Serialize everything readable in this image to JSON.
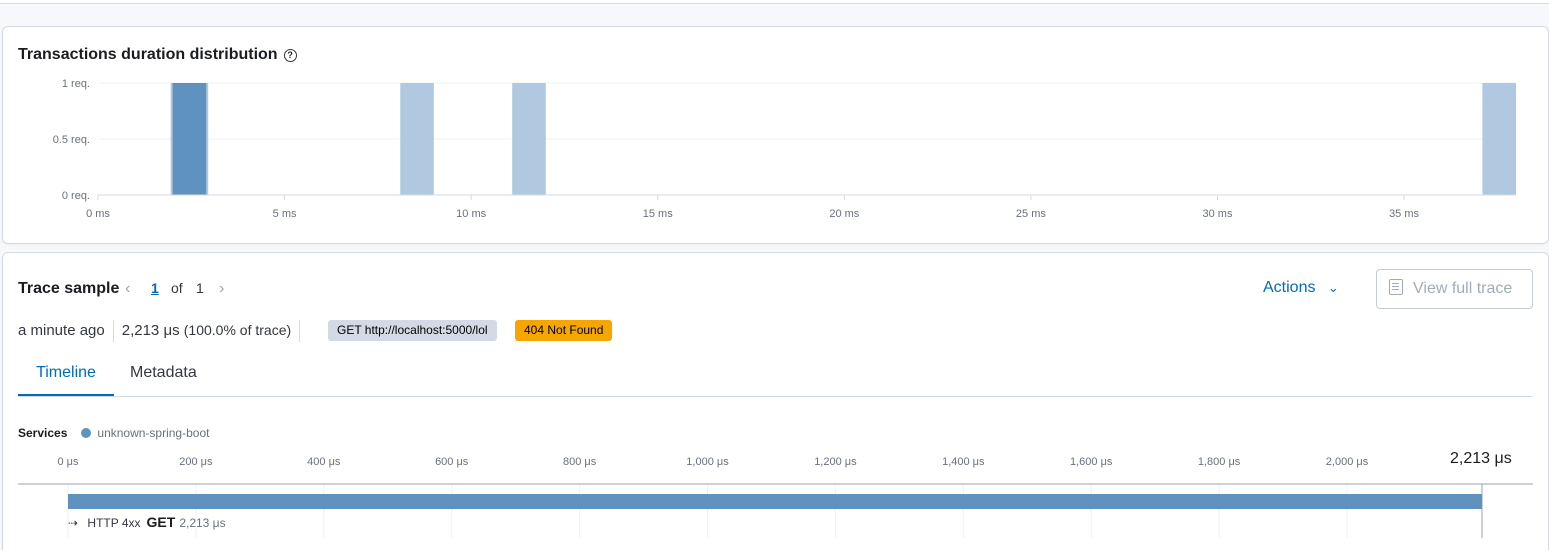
{
  "distribution": {
    "title": "Transactions duration distribution",
    "help_icon": "question-circle-icon"
  },
  "chart_data": {
    "type": "bar",
    "x_unit": "ms",
    "y_ticks": [
      "1 req.",
      "0.5 req.",
      "0 req."
    ],
    "x_ticks": [
      "0 ms",
      "5 ms",
      "10 ms",
      "15 ms",
      "20 ms",
      "25 ms",
      "30 ms",
      "35 ms"
    ],
    "xlim": [
      0,
      38
    ],
    "ylim": [
      0,
      1
    ],
    "bucket_size": 0.9,
    "buckets": [
      {
        "x": 2.0,
        "value": 1,
        "selected": true
      },
      {
        "x": 8.1,
        "value": 1,
        "selected": false
      },
      {
        "x": 11.1,
        "value": 1,
        "selected": false
      },
      {
        "x": 37.1,
        "value": 1,
        "selected": false
      }
    ],
    "colors": {
      "selected": "#6092c0",
      "default": "#b0c9e0"
    },
    "grid": true
  },
  "trace": {
    "title": "Trace sample",
    "page_current": "1",
    "page_of": "of",
    "page_total": "1",
    "actions_label": "Actions",
    "view_full_trace_label": "View full trace",
    "timestamp": "a minute ago",
    "duration": "2,213 μs",
    "duration_pct": "(100.0% of trace)",
    "request_badge": "GET http://localhost:5000/lol",
    "status_badge": "404 Not Found",
    "tabs": [
      {
        "label": "Timeline",
        "active": true
      },
      {
        "label": "Metadata",
        "active": false
      }
    ],
    "services_label": "Services",
    "service_name": "unknown-spring-boot",
    "timeline_ticks": [
      "0 μs",
      "200 μs",
      "400 μs",
      "600 μs",
      "800 μs",
      "1,000 μs",
      "1,200 μs",
      "1,400 μs",
      "1,600 μs",
      "1,800 μs",
      "2,000 μs"
    ],
    "timeline_total": "2,213 μs",
    "span": {
      "type": "HTTP 4xx",
      "name": "GET",
      "duration": "2,213 μs",
      "icon": "exit-arrow-icon"
    }
  }
}
